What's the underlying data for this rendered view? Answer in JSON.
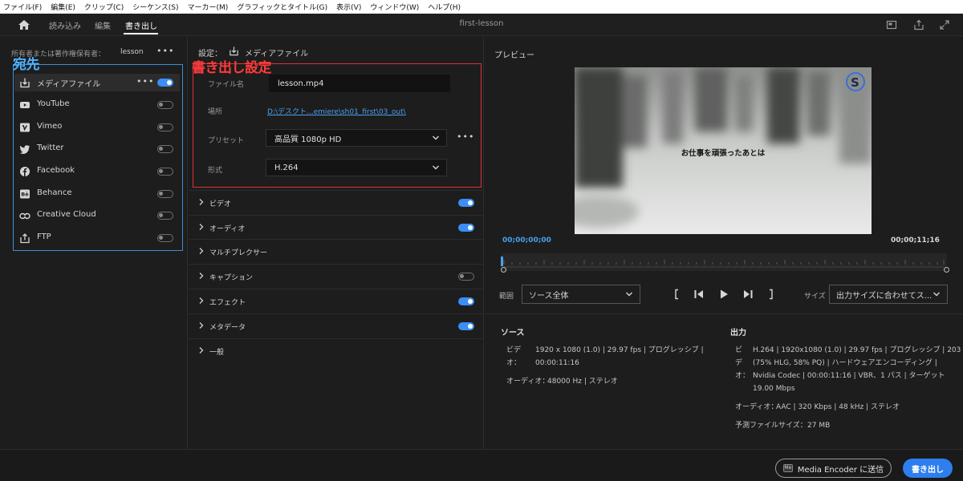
{
  "menu": [
    "ファイル(F)",
    "編集(E)",
    "クリップ(C)",
    "シーケンス(S)",
    "マーカー(M)",
    "グラフィックとタイトル(G)",
    "表示(V)",
    "ウィンドウ(W)",
    "ヘルプ(H)"
  ],
  "nav": {
    "tabs": [
      "読み込み",
      "編集",
      "書き出し"
    ],
    "active_tab": "書き出し",
    "document_title": "first-lesson"
  },
  "left_panel": {
    "owner_label": "所有者または著作権保有者：",
    "owner_value": "lesson",
    "annotation": "宛先",
    "destinations": [
      {
        "label": "メディアファイル",
        "icon": "media-file-icon",
        "enabled": true
      },
      {
        "label": "YouTube",
        "icon": "youtube-icon",
        "enabled": false
      },
      {
        "label": "Vimeo",
        "icon": "vimeo-icon",
        "enabled": false
      },
      {
        "label": "Twitter",
        "icon": "twitter-icon",
        "enabled": false
      },
      {
        "label": "Facebook",
        "icon": "facebook-icon",
        "enabled": false
      },
      {
        "label": "Behance",
        "icon": "behance-icon",
        "enabled": false
      },
      {
        "label": "Creative Cloud",
        "icon": "creative-cloud-icon",
        "enabled": false
      },
      {
        "label": "FTP",
        "icon": "ftp-icon",
        "enabled": false
      }
    ]
  },
  "mid_panel": {
    "header_label": "設定：",
    "header_value": "メディアファイル",
    "annotation": "書き出し設定",
    "filename_label": "ファイル名",
    "filename_value": "lesson.mp4",
    "location_label": "場所",
    "location_value": "D:\\デスクト...emiere\\sh01_first\\03_out\\",
    "preset_label": "プリセット",
    "preset_value": "高品質 1080p HD",
    "format_label": "形式",
    "format_value": "H.264",
    "sections": [
      {
        "label": "ビデオ",
        "toggle": "on"
      },
      {
        "label": "オーディオ",
        "toggle": "on"
      },
      {
        "label": "マルチプレクサー",
        "toggle": "none"
      },
      {
        "label": "キャプション",
        "toggle": "off"
      },
      {
        "label": "エフェクト",
        "toggle": "on"
      },
      {
        "label": "メタデータ",
        "toggle": "on"
      },
      {
        "label": "一般",
        "toggle": "none"
      }
    ]
  },
  "preview": {
    "title": "プレビュー",
    "caption": "お仕事を頑張ったあとは",
    "timecode_start": "00;00;00;00",
    "timecode_end": "00;00;11;16",
    "range_label": "範囲",
    "range_value": "ソース全体",
    "size_label": "サイズ",
    "size_value": "出力サイズに合わせてス..."
  },
  "source_info": {
    "heading": "ソース",
    "video_label_1": "ビデ",
    "video_label_2": "オ：",
    "video_line_1": "1920 x 1080 (1.0)  |  29.97 fps  |  プログレッシブ  |",
    "video_line_2": "00:00:11:16",
    "audio_label": "オーディオ：",
    "audio_value": "48000 Hz  |  ステレオ"
  },
  "output_info": {
    "heading": "出力",
    "video_label_1": "ビ",
    "video_label_2": "デ",
    "video_label_3": "オ：",
    "video_line_1": "H.264  |  1920x1080 (1.0)  |  29.97 fps  |  プログレッシブ  |  203",
    "video_line_2": "(75% HLG, 58% PQ)  |  ハードウェアエンコーディング  |",
    "video_line_3": "Nvidia Codec  |  00:00:11:16  |  VBR、1 パス  |  ターゲット",
    "video_line_4": "19.00 Mbps",
    "audio_label": "オーディオ：",
    "audio_value": "AAC  |  320 Kbps  |  48 kHz  |  ステレオ",
    "filesize_label": "予測ファイルサイズ：",
    "filesize_value": "27 MB"
  },
  "footer": {
    "media_encoder_label": "Media Encoder に送信",
    "export_label": "書き出し"
  },
  "colors": {
    "accent": "#2e7ef0",
    "annotation_blue": "#4cb3ff",
    "annotation_red": "#ff3b3b",
    "timecode_blue": "#4a9ff0"
  }
}
